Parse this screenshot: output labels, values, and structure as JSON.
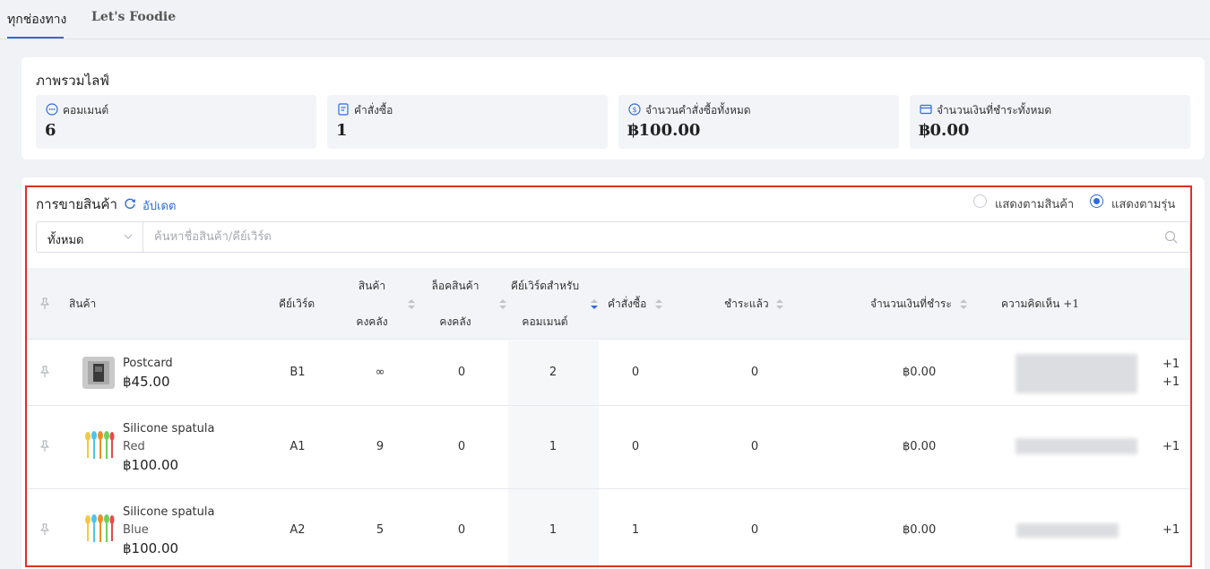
{
  "tabs": [
    {
      "label": "ทุกช่องทาง"
    },
    {
      "label": "Let's Foodie"
    }
  ],
  "overview": {
    "title": "ภาพรวมไลฟ์",
    "stats": [
      {
        "label": "คอมเมนต์",
        "value": "6",
        "icon": "comment-icon"
      },
      {
        "label": "คำสั่งซื้อ",
        "value": "1",
        "icon": "order-icon"
      },
      {
        "label": "จำนวนคำสั่งซื้อทั้งหมด",
        "value": "฿100.00",
        "icon": "dollar-circle-icon"
      },
      {
        "label": "จำนวนเงินที่ชำระทั้งหมด",
        "value": "฿0.00",
        "icon": "credit-card-icon"
      }
    ]
  },
  "sales": {
    "title": "การขายสินค้า",
    "refresh_label": "อัปเดต",
    "view_by_product": "แสดงตามสินค้า",
    "view_by_variant": "แสดงตามรุ่น",
    "filter_value": "ทั้งหมด",
    "search_placeholder": "ค้นหาชื่อสินค้า/คีย์เวิร์ด",
    "columns": {
      "product": "สินค้า",
      "keyword": "คีย์เวิร์ด",
      "stock_line1": "สินค้า",
      "stock_line2": "คงคลัง",
      "locked_line1": "ล็อคสินค้า",
      "locked_line2": "คงคลัง",
      "comment_kw_line1": "คีย์เวิร์ดสำหรับ",
      "comment_kw_line2": "คอมเมนต์",
      "orders": "คำสั่งซื้อ",
      "paid": "ชำระแล้ว",
      "paid_amount": "จำนวนเงินที่ชำระ",
      "comments": "ความคิดเห็น +1"
    },
    "rows": [
      {
        "name": "Postcard",
        "variant": "",
        "price": "฿45.00",
        "keyword": "B1",
        "stock": "∞",
        "locked": "0",
        "comment_kw": "2",
        "orders": "0",
        "paid": "0",
        "paid_amount": "฿0.00",
        "plus": [
          "+1",
          "+1"
        ]
      },
      {
        "name": "Silicone spatula",
        "variant": "Red",
        "price": "฿100.00",
        "keyword": "A1",
        "stock": "9",
        "locked": "0",
        "comment_kw": "1",
        "orders": "0",
        "paid": "0",
        "paid_amount": "฿0.00",
        "plus": [
          "+1"
        ]
      },
      {
        "name": "Silicone spatula",
        "variant": "Blue",
        "price": "฿100.00",
        "keyword": "A2",
        "stock": "5",
        "locked": "0",
        "comment_kw": "1",
        "orders": "1",
        "paid": "0",
        "paid_amount": "฿0.00",
        "plus": [
          "+1"
        ]
      }
    ]
  },
  "colors": {
    "accent": "#2e6bdc",
    "highlight": "#e0301e"
  }
}
